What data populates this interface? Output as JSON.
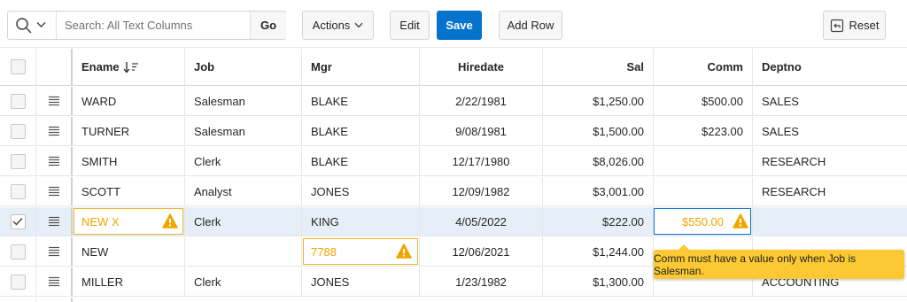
{
  "toolbar": {
    "search_placeholder": "Search: All Text Columns",
    "go_label": "Go",
    "actions_label": "Actions",
    "edit_label": "Edit",
    "save_label": "Save",
    "add_row_label": "Add Row",
    "reset_label": "Reset"
  },
  "columns": {
    "ename": "Ename",
    "job": "Job",
    "mgr": "Mgr",
    "hiredate": "Hiredate",
    "sal": "Sal",
    "comm": "Comm",
    "deptno": "Deptno"
  },
  "rows": [
    {
      "ename": "WARD",
      "job": "Salesman",
      "mgr": "BLAKE",
      "hiredate": "2/22/1981",
      "sal": "$1,250.00",
      "comm": "$500.00",
      "deptno": "SALES"
    },
    {
      "ename": "TURNER",
      "job": "Salesman",
      "mgr": "BLAKE",
      "hiredate": "9/08/1981",
      "sal": "$1,500.00",
      "comm": "$223.00",
      "deptno": "SALES"
    },
    {
      "ename": "SMITH",
      "job": "Clerk",
      "mgr": "BLAKE",
      "hiredate": "12/17/1980",
      "sal": "$8,026.00",
      "comm": "",
      "deptno": "RESEARCH"
    },
    {
      "ename": "SCOTT",
      "job": "Analyst",
      "mgr": "JONES",
      "hiredate": "12/09/1982",
      "sal": "$3,001.00",
      "comm": "",
      "deptno": "RESEARCH"
    },
    {
      "ename": "NEW X",
      "job": "Clerk",
      "mgr": "KING",
      "hiredate": "4/05/2022",
      "sal": "$222.00",
      "comm": "$550.00",
      "deptno": ""
    },
    {
      "ename": "NEW",
      "job": "",
      "mgr": "7788",
      "hiredate": "12/06/2021",
      "sal": "$1,244.00",
      "comm": "",
      "deptno": ""
    },
    {
      "ename": "MILLER",
      "job": "Clerk",
      "mgr": "JONES",
      "hiredate": "1/23/1982",
      "sal": "$1,300.00",
      "comm": "",
      "deptno": "ACCOUNTING"
    }
  ],
  "tooltip": "Comm must have a value only when Job is Salesman.",
  "colors": {
    "accent": "#0572ce",
    "warning": "#f0b429",
    "tooltip_bg": "#fcc934",
    "selected_row": "#e6eff8"
  }
}
